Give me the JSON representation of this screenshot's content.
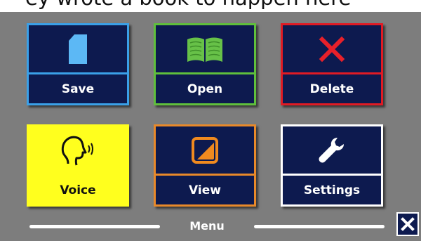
{
  "top_text": "ey wrote a book to happen here",
  "tiles": [
    {
      "label": "Save",
      "icon": "document-icon",
      "border_color": "#3aa0e8"
    },
    {
      "label": "Open",
      "icon": "open-book-icon",
      "border_color": "#5fbf3c"
    },
    {
      "label": "Delete",
      "icon": "x-mark-icon",
      "border_color": "#e01b24"
    },
    {
      "label": "Voice",
      "icon": "speaking-head-icon",
      "border_color": "#ffff1e"
    },
    {
      "label": "View",
      "icon": "contrast-square-icon",
      "border_color": "#e8892a"
    },
    {
      "label": "Settings",
      "icon": "wrench-icon",
      "border_color": "#ffffff"
    }
  ],
  "menu": {
    "label": "Menu"
  },
  "close_button": {
    "icon": "close-icon"
  },
  "colors": {
    "panel_background": "#7d7d7d",
    "tile_background": "#0d1a4f",
    "voice_tile_background": "#ffff1e"
  }
}
